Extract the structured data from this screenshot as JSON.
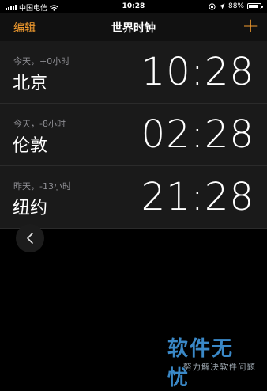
{
  "status_bar": {
    "carrier": "中国电信",
    "time": "10:28",
    "battery_percent": "88%",
    "battery_level": 0.88
  },
  "nav": {
    "edit_label": "编辑",
    "title": "世界时钟",
    "add_label": "+"
  },
  "clocks": [
    {
      "offset": "今天，+0小时",
      "city": "北京",
      "time": "10:28"
    },
    {
      "offset": "今天，-8小时",
      "city": "伦敦",
      "time": "02:28"
    },
    {
      "offset": "昨天，-13小时",
      "city": "纽约",
      "time": "21:28"
    }
  ],
  "watermark": {
    "title": "软件无忧",
    "subtitle": "努力解决软件问题"
  },
  "colors": {
    "accent": "#f59d2e",
    "row_background": "#1a1a1a",
    "secondary_text": "#8e8e93"
  }
}
